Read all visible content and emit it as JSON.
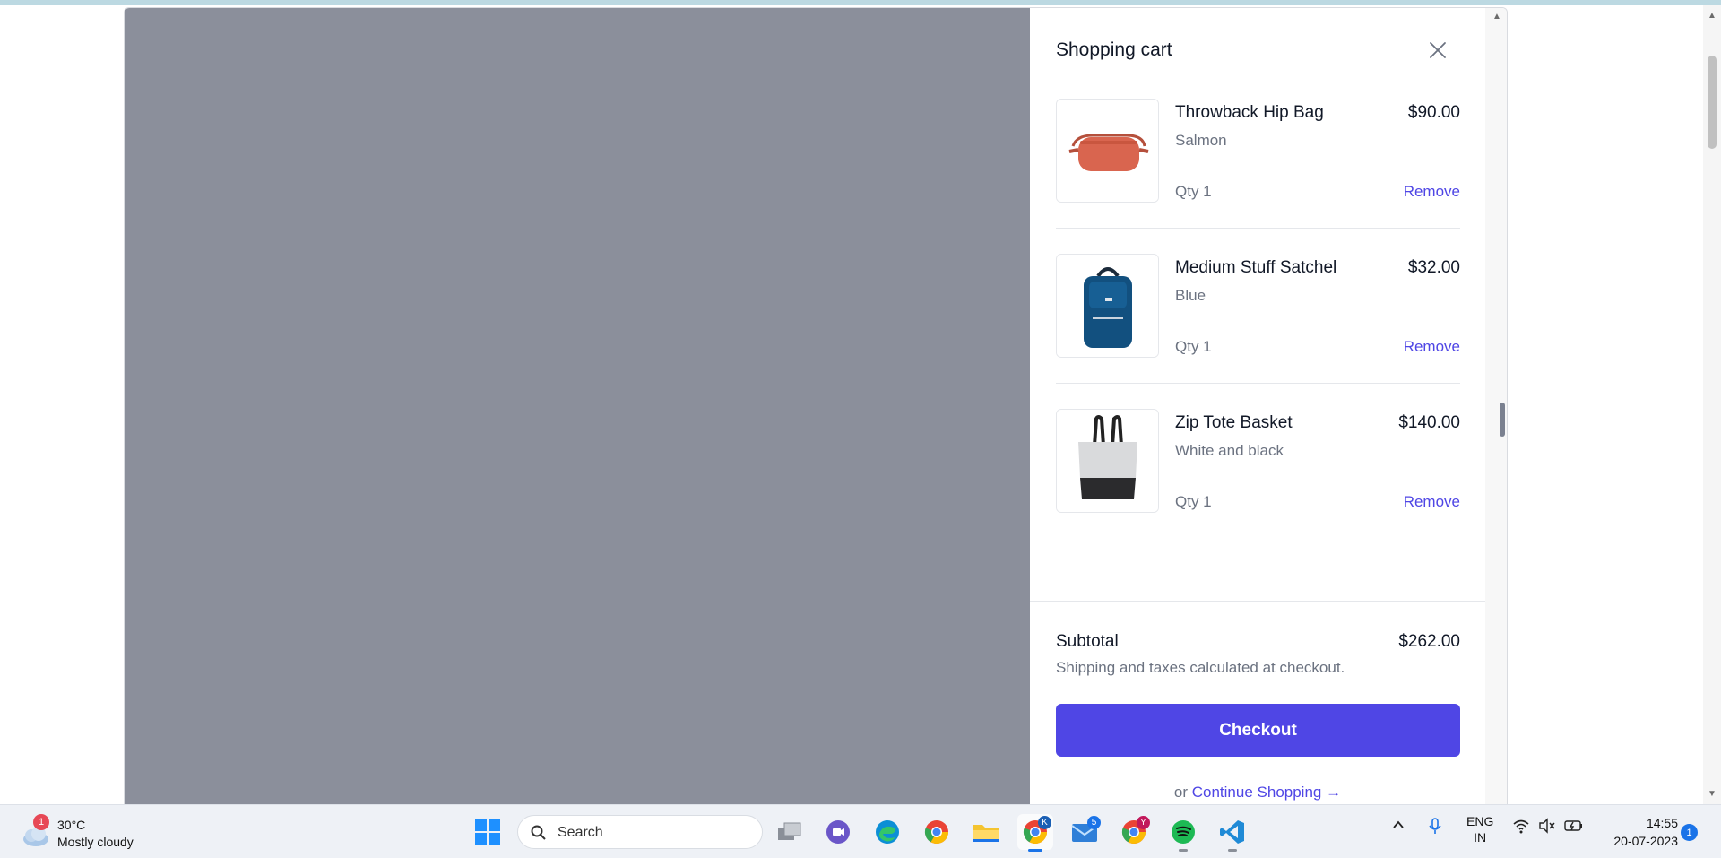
{
  "cart": {
    "title": "Shopping cart",
    "items": [
      {
        "name": "Throwback Hip Bag",
        "color": "Salmon",
        "price": "$90.00",
        "qty": "Qty 1",
        "remove": "Remove",
        "image": "salmon-hip-bag"
      },
      {
        "name": "Medium Stuff Satchel",
        "color": "Blue",
        "price": "$32.00",
        "qty": "Qty 1",
        "remove": "Remove",
        "image": "blue-satchel-backpack"
      },
      {
        "name": "Zip Tote Basket",
        "color": "White and black",
        "price": "$140.00",
        "qty": "Qty 1",
        "remove": "Remove",
        "image": "white-black-tote"
      }
    ],
    "subtotal_label": "Subtotal",
    "subtotal_value": "$262.00",
    "shipping_note": "Shipping and taxes calculated at checkout.",
    "checkout_label": "Checkout",
    "continue_prefix": "or",
    "continue_label": "Continue Shopping →"
  },
  "colors": {
    "accent": "#4f46e5",
    "overlay": "#8b8f9b"
  },
  "taskbar": {
    "weather": {
      "temp": "30°C",
      "desc": "Mostly cloudy",
      "badge": "1"
    },
    "search_label": "Search",
    "apps": [
      {
        "name": "windows-start-icon"
      },
      {
        "name": "task-view-icon"
      },
      {
        "name": "meet-icon"
      },
      {
        "name": "edge-icon"
      },
      {
        "name": "chrome-icon"
      },
      {
        "name": "file-explorer-icon"
      },
      {
        "name": "chrome-profile-k-icon",
        "badge": "K"
      },
      {
        "name": "mail-icon",
        "badge": "5"
      },
      {
        "name": "chrome-profile-y-icon",
        "badge": "Y"
      },
      {
        "name": "spotify-icon"
      },
      {
        "name": "vscode-icon"
      }
    ],
    "lang_line1": "ENG",
    "lang_line2": "IN",
    "time": "14:55",
    "date": "20-07-2023",
    "notification_count": "1"
  }
}
